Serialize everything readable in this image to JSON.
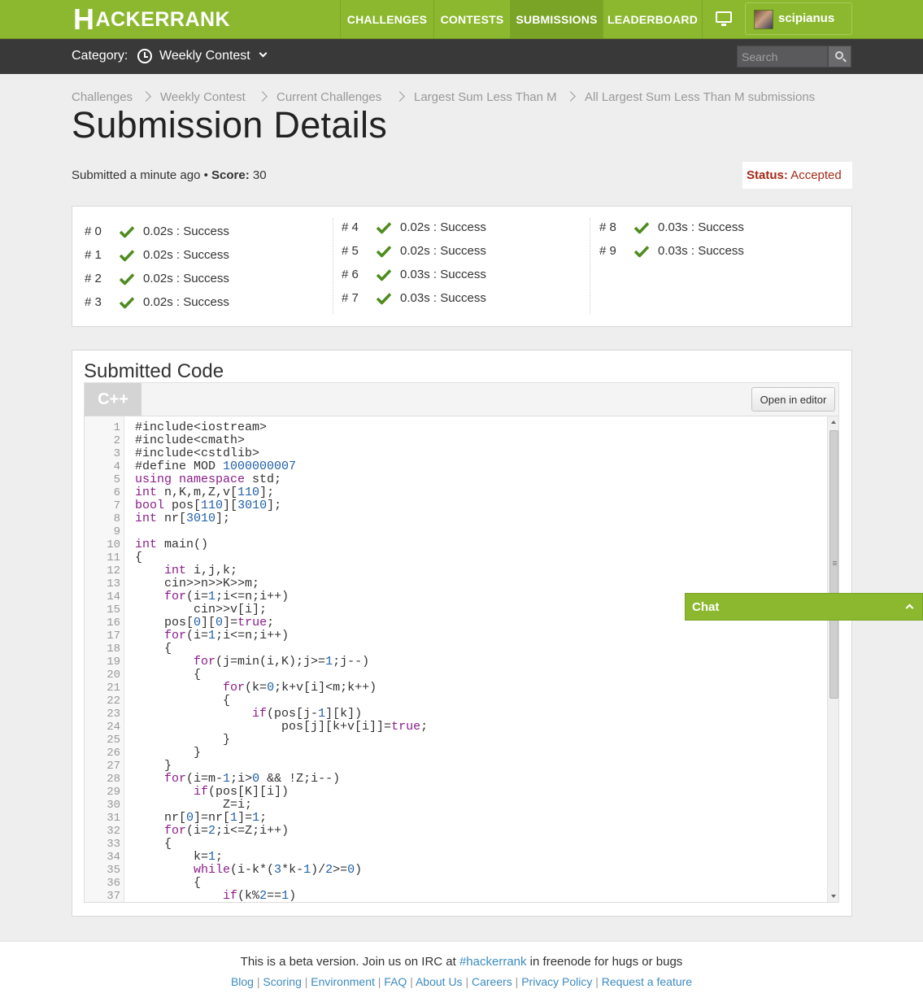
{
  "brand": {
    "logo_big": "H",
    "logo_rest": "ACKERRANK"
  },
  "nav": {
    "challenges": "CHALLENGES",
    "contests": "CONTESTS",
    "submissions": "SUBMISSIONS",
    "leaderboard": "LEADERBOARD",
    "username": "scipianus"
  },
  "subbar": {
    "category_label": "Category:",
    "category_value": "Weekly Contest",
    "search_placeholder": "Search"
  },
  "breadcrumbs": [
    "Challenges",
    "Weekly Contest",
    "Current Challenges",
    "Largest Sum Less Than M",
    "All Largest Sum Less Than M submissions"
  ],
  "page": {
    "title": "Submission Details",
    "submitted": "Submitted a minute ago",
    "bullet": " • ",
    "score_label": "Score:",
    "score_value": " 30",
    "status_label": "Status:",
    "status_value": " Accepted"
  },
  "colors": {
    "brand_green": "#8cb82f",
    "status_red": "#a52a1a",
    "link_blue": "#3d8bbf",
    "check_green": "#4e8c1f"
  },
  "test_cases": [
    {
      "num": "# 0",
      "result": "0.02s : Success"
    },
    {
      "num": "# 1",
      "result": "0.02s : Success"
    },
    {
      "num": "# 2",
      "result": "0.02s : Success"
    },
    {
      "num": "# 3",
      "result": "0.02s : Success"
    },
    {
      "num": "# 4",
      "result": "0.02s : Success"
    },
    {
      "num": "# 5",
      "result": "0.02s : Success"
    },
    {
      "num": "# 6",
      "result": "0.03s : Success"
    },
    {
      "num": "# 7",
      "result": "0.03s : Success"
    },
    {
      "num": "# 8",
      "result": "0.03s : Success"
    },
    {
      "num": "# 9",
      "result": "0.03s : Success"
    }
  ],
  "code": {
    "heading": "Submitted Code",
    "language": "C++",
    "open_editor": "Open in editor",
    "lines": [
      "#include<iostream>",
      "#include<cmath>",
      "#include<cstdlib>",
      "#define MOD 1000000007",
      "using namespace std;",
      "int n,K,m,Z,v[110];",
      "bool pos[110][3010];",
      "int nr[3010];",
      "",
      "int main()",
      "{",
      "    int i,j,k;",
      "    cin>>n>>K>>m;",
      "    for(i=1;i<=n;i++)",
      "        cin>>v[i];",
      "    pos[0][0]=true;",
      "    for(i=1;i<=n;i++)",
      "    {",
      "        for(j=min(i,K);j>=1;j--)",
      "        {",
      "            for(k=0;k+v[i]<m;k++)",
      "            {",
      "                if(pos[j-1][k])",
      "                    pos[j][k+v[i]]=true;",
      "            }",
      "        }",
      "    }",
      "    for(i=m-1;i>0 && !Z;i--)",
      "        if(pos[K][i])",
      "            Z=i;",
      "    nr[0]=nr[1]=1;",
      "    for(i=2;i<=Z;i++)",
      "    {",
      "        k=1;",
      "        while(i-k*(3*k-1)/2>=0)",
      "        {",
      "            if(k%2==1)"
    ]
  },
  "chat": {
    "label": "Chat"
  },
  "footer": {
    "pre": "This is a beta version. Join us on IRC at ",
    "irc": "#hackerrank",
    "post": " in freenode for hugs or bugs",
    "links": [
      "Blog",
      "Scoring",
      "Environment",
      "FAQ",
      "About Us",
      "Careers",
      "Privacy Policy",
      "Request a feature"
    ]
  }
}
